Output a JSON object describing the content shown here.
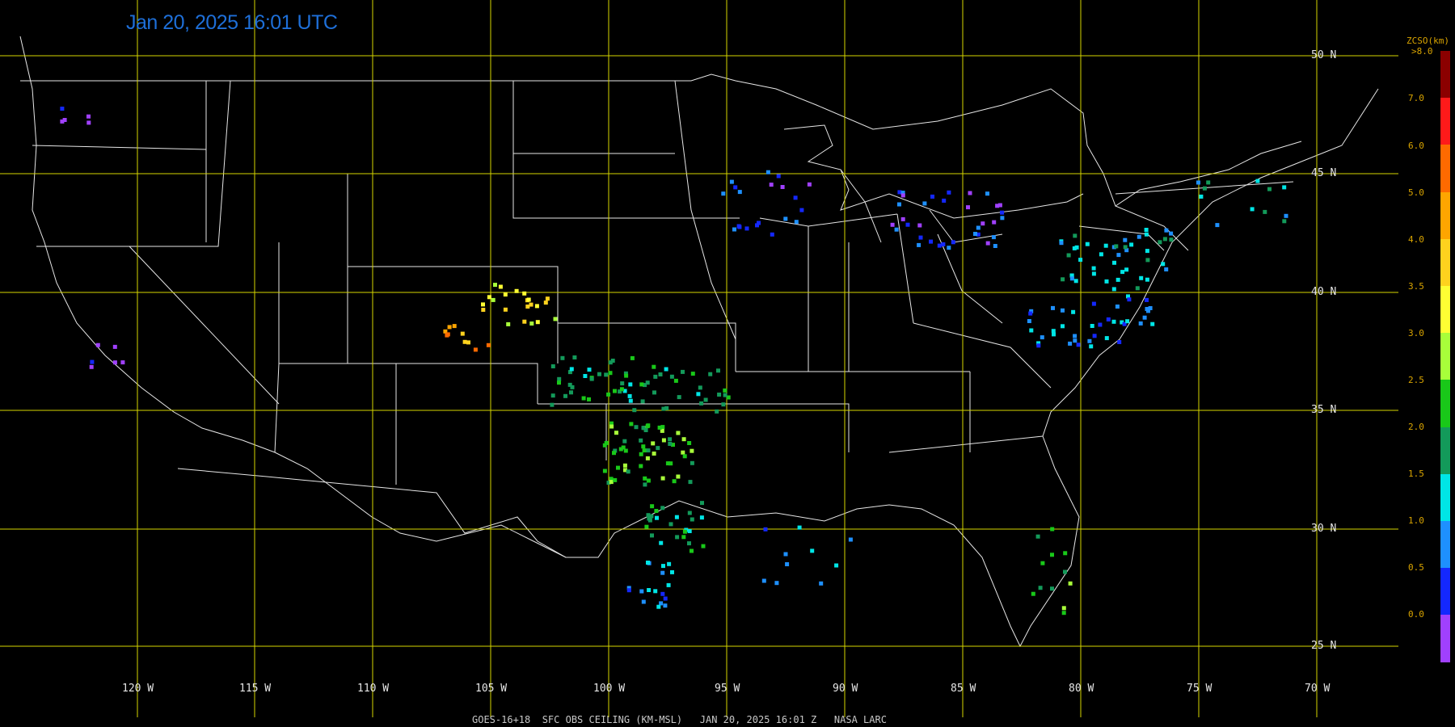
{
  "header": {
    "timestamp": "Jan 20, 2025 16:01 UTC"
  },
  "footer": {
    "caption": "GOES-16+18  SFC OBS CEILING (KM-MSL)   JAN 20, 2025 16:01 Z   NASA LARC"
  },
  "grid": {
    "lat_labels": [
      "50 N",
      "45 N",
      "40 N",
      "35 N",
      "30 N",
      "25 N"
    ],
    "lon_labels": [
      "120 W",
      "115 W",
      "110 W",
      "105 W",
      "100 W",
      "95 W",
      "90 W",
      "85 W",
      "80 W",
      "75 W",
      "70 W"
    ]
  },
  "legend": {
    "title": "ZCSO(km)",
    "top_label": ">8.0",
    "tick_labels": [
      "7.0",
      "6.0",
      "5.0",
      "4.0",
      "3.5",
      "3.0",
      "2.5",
      "2.0",
      "1.5",
      "1.0",
      "0.5",
      "0.0"
    ],
    "colors": [
      "#8b0000",
      "#ff1a1a",
      "#ff6a00",
      "#ffa500",
      "#ffd21e",
      "#ffff33",
      "#a8ff3a",
      "#19c819",
      "#139a5a",
      "#00e6e6",
      "#1e90ff",
      "#1428ff",
      "#a040ff"
    ]
  },
  "colors": {
    "grid": "#d6d600",
    "borders": "#e0e0e0",
    "timestamp": "#1e6fd8"
  }
}
